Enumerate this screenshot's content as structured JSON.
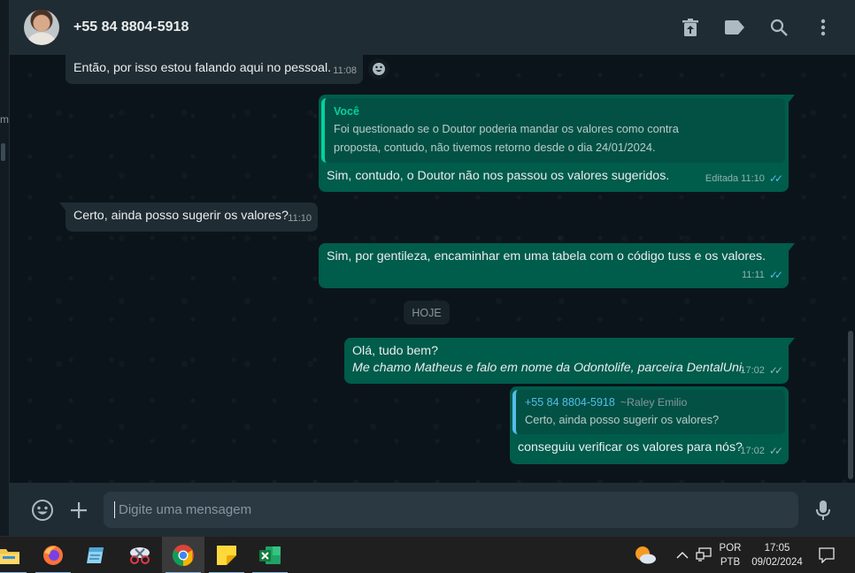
{
  "left_pane": {
    "fragment": "m"
  },
  "header": {
    "contact_name": "+55 84 8804-5918",
    "icons": [
      "delete-icon",
      "label-icon",
      "search-icon",
      "menu-icon"
    ]
  },
  "messages": [
    {
      "direction": "in",
      "text": "Então, por isso estou falando aqui no pessoal.",
      "time": "11:08"
    },
    {
      "direction": "out",
      "quote_author": "Você",
      "quote_text_line1": "Foi questionado se o Doutor poderia mandar os valores como contra",
      "quote_text_line2": "proposta, contudo, não tivemos retorno desde o dia 24/01/2024.",
      "text": "Sim, contudo, o Doutor não nos passou os valores sugeridos.",
      "edited": "Editada",
      "time": "11:10",
      "status": "read"
    },
    {
      "direction": "in",
      "text": "Certo, ainda posso sugerir os valores?",
      "time": "11:10"
    },
    {
      "direction": "out",
      "text": "Sim, por gentileza, encaminhar em uma tabela com o código tuss e os valores.",
      "time": "11:11",
      "status": "read"
    },
    {
      "direction": "out",
      "text_line1": "Olá, tudo bem?",
      "text_line2": "Me chamo Matheus e falo em nome da Odontolife, parceira DentalUni.",
      "time": "17:02",
      "status": "delivered"
    },
    {
      "direction": "out",
      "quote_author": "+55 84 8804-5918",
      "quote_alias": "~Raley Emilio",
      "quote_text": "Certo, ainda posso sugerir os valores?",
      "text": "conseguiu verificar os valores para nós?",
      "time": "17:02",
      "status": "delivered"
    }
  ],
  "day_separator": "HOJE",
  "composer": {
    "placeholder": "Digite uma mensagem",
    "icons": [
      "emoji-icon",
      "attach-plus-icon",
      "mic-icon"
    ]
  },
  "taskbar": {
    "apps": [
      "file-explorer-icon",
      "firefox-icon",
      "notepad-icon",
      "snipping-tool-icon",
      "chrome-icon",
      "sticky-notes-icon",
      "excel-icon"
    ],
    "active_app": "chrome-icon",
    "language_line1": "POR",
    "language_line2": "PTB",
    "time": "17:05",
    "date": "09/02/2024"
  },
  "colors": {
    "background": "#0b141a",
    "panel": "#202c33",
    "incoming_bubble": "#202c33",
    "outgoing_bubble": "#005c4b",
    "read_ticks": "#53bdeb",
    "accent_green": "#06cf9c"
  }
}
